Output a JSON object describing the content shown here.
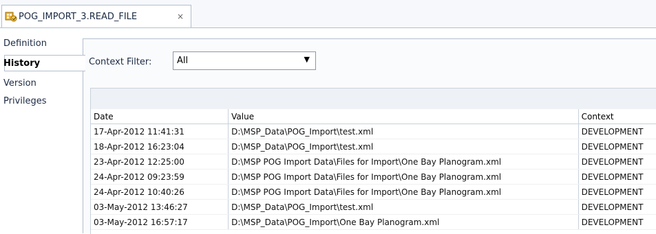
{
  "tab": {
    "title": "POG_IMPORT_3.READ_FILE",
    "close": "×",
    "icon": "database-object-icon"
  },
  "sidebar": {
    "items": [
      {
        "label": "Definition",
        "active": false
      },
      {
        "label": "History",
        "active": true
      },
      {
        "label": "Version",
        "active": false
      },
      {
        "label": "Privileges",
        "active": false
      }
    ]
  },
  "filter": {
    "label": "Context Filter:",
    "value": "All",
    "arrow": "▼"
  },
  "table": {
    "columns": [
      "Date",
      "Value",
      "Context"
    ],
    "rows": [
      [
        "17-Apr-2012 11:41:31",
        "D:\\MSP_Data\\POG_Import\\test.xml",
        "DEVELOPMENT"
      ],
      [
        "18-Apr-2012 16:23:04",
        "D:\\MSP_Data\\POG_Import\\test.xml",
        "DEVELOPMENT"
      ],
      [
        "23-Apr-2012 12:25:00",
        "D:\\MSP POG Import Data\\Files for Import\\One Bay Planogram.xml",
        "DEVELOPMENT"
      ],
      [
        "24-Apr-2012 09:23:59",
        "D:\\MSP POG Import Data\\Files for Import\\One Bay Planogram.xml",
        "DEVELOPMENT"
      ],
      [
        "24-Apr-2012 10:40:26",
        "D:\\MSP POG Import Data\\Files for Import\\One Bay Planogram.xml",
        "DEVELOPMENT"
      ],
      [
        "03-May-2012 13:46:27",
        "D:\\MSP_Data\\POG_Import\\test.xml",
        "DEVELOPMENT"
      ],
      [
        "03-May-2012 16:57:17",
        "D:\\MSP_Data\\POG_Import\\One Bay Planogram.xml",
        "DEVELOPMENT"
      ]
    ]
  }
}
